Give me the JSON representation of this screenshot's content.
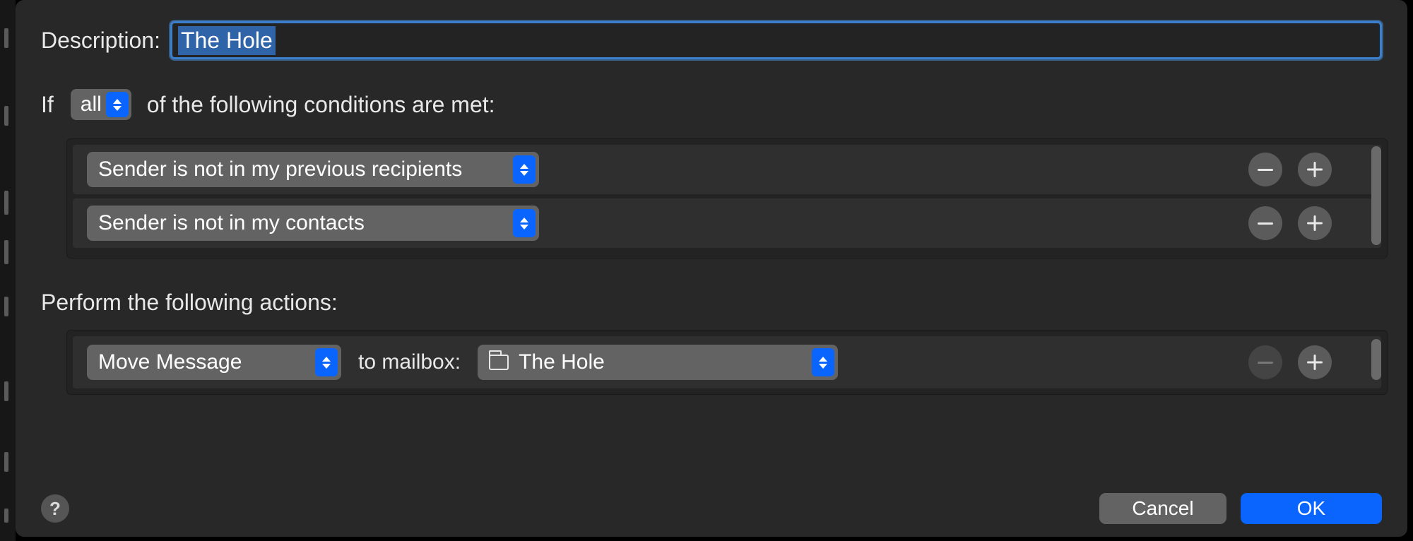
{
  "description": {
    "label": "Description:",
    "value": "The Hole"
  },
  "ifRow": {
    "prefix": "If",
    "match": "all",
    "suffix": "of the following conditions are met:"
  },
  "conditions": [
    {
      "criterion": "Sender is not in my previous recipients"
    },
    {
      "criterion": "Sender is not in my contacts"
    }
  ],
  "actionsHeader": "Perform the following actions:",
  "actions": [
    {
      "type": "Move Message",
      "mailboxLabel": "to mailbox:",
      "mailbox": "The Hole",
      "removeDisabled": true
    }
  ],
  "buttons": {
    "help": "?",
    "cancel": "Cancel",
    "ok": "OK"
  }
}
